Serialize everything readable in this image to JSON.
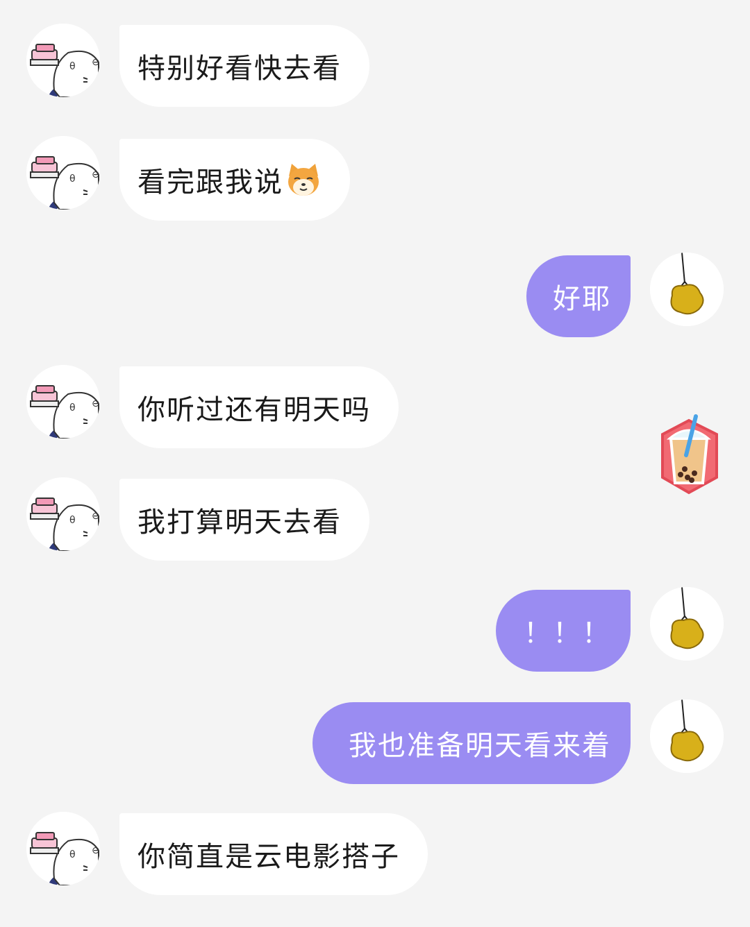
{
  "chat": {
    "messages": [
      {
        "side": "left",
        "text": "特别好看快去看"
      },
      {
        "side": "left",
        "text": "看完跟我说",
        "emoji": "shiba-dog-emoji"
      },
      {
        "side": "right",
        "text": "好耶"
      },
      {
        "side": "left",
        "text": "你听过还有明天吗"
      },
      {
        "side": "left",
        "text": "我打算明天去看"
      },
      {
        "side": "right",
        "text": "！！！"
      },
      {
        "side": "right",
        "text": "我也准备明天看来着"
      },
      {
        "side": "left",
        "text": "你简直是云电影搭子"
      }
    ],
    "sticker": {
      "name": "bubble-tea-sticker"
    }
  },
  "colors": {
    "background": "#f4f4f4",
    "left_bubble": "#ffffff",
    "right_bubble": "#9a8cf2",
    "right_text": "#ffffff"
  }
}
